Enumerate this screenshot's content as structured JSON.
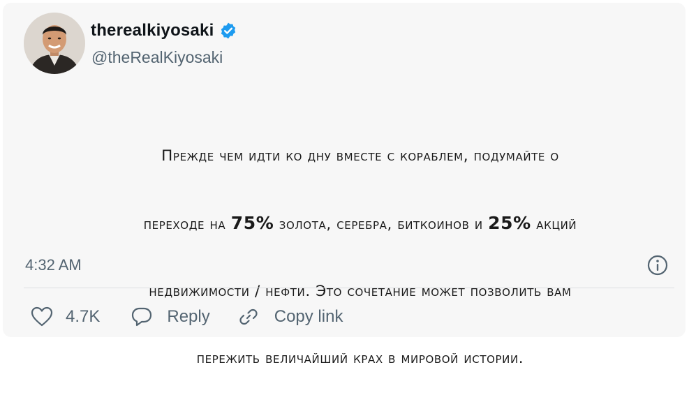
{
  "author": {
    "display_name": "therealkiyosaki",
    "handle": "@theRealKiyosaki",
    "verified": true,
    "verified_color": "#1d9bf0"
  },
  "tweet": {
    "text_lines": [
      "Прежде чем идти ко дну вместе с кораблем, подумайте о",
      [
        "переходе на ",
        "75%",
        " золота, серебра, биткоинов и ",
        "25%",
        " акций"
      ],
      "недвижимости / нефти. Это сочетание может позволить вам",
      "пережить величайший крах в мировой истории."
    ],
    "timestamp": "4:32 AM"
  },
  "actions": {
    "like_count": "4.7K",
    "reply_label": "Reply",
    "copy_label": "Copy link"
  },
  "icons": {
    "verified": "verified-badge-icon",
    "info": "info-icon",
    "like": "heart-icon",
    "reply": "speech-bubble-icon",
    "copy": "link-icon"
  },
  "colors": {
    "card_background": "#f7f7f7",
    "secondary_text": "#536471",
    "primary_text": "#0f1419"
  }
}
